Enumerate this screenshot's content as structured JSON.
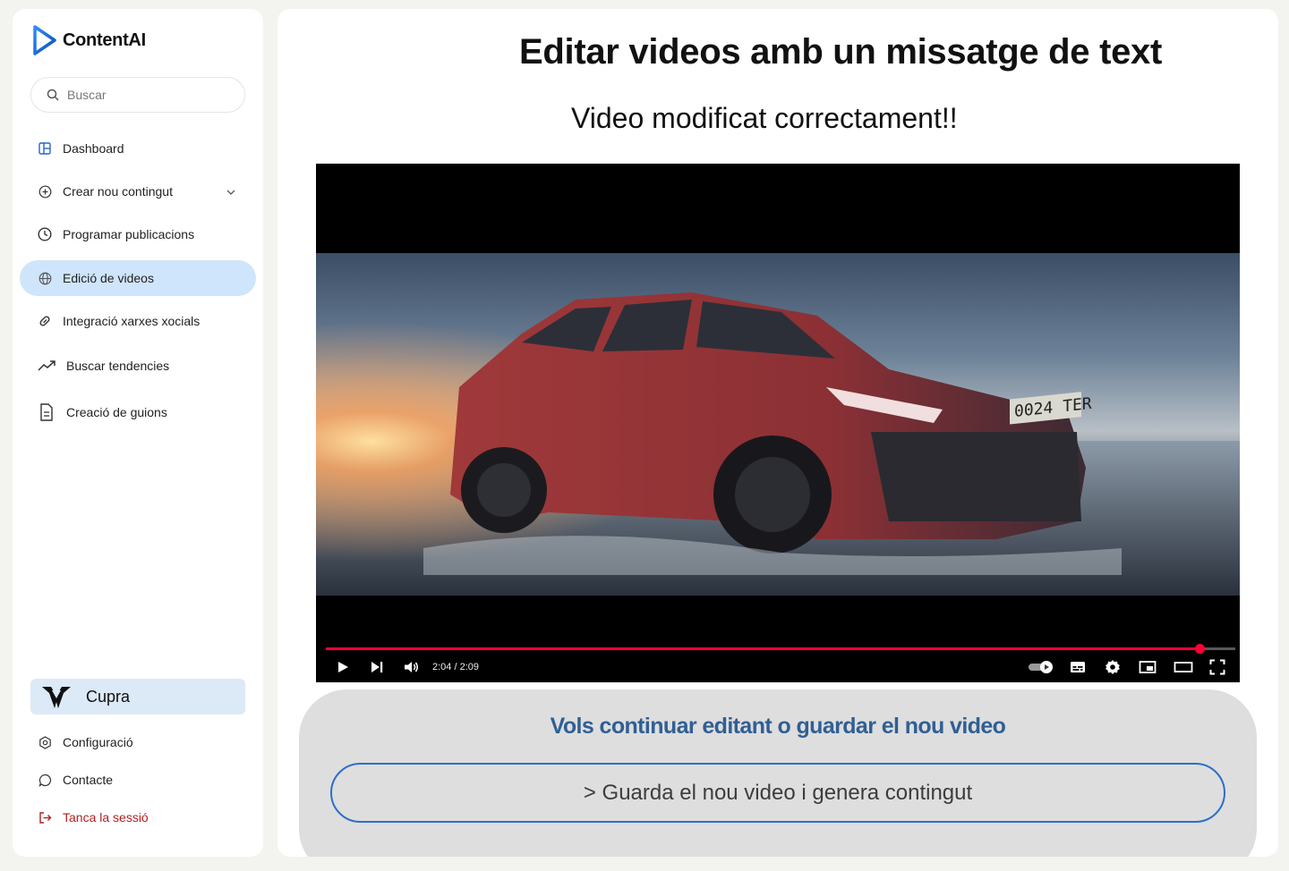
{
  "app": {
    "name": "ContentAI"
  },
  "search": {
    "placeholder": "Buscar"
  },
  "sidebar": {
    "items": [
      {
        "label": "Dashboard",
        "icon": "dashboard-icon"
      },
      {
        "label": "Crear nou contingut",
        "icon": "plus-circle-icon"
      },
      {
        "label": "Programar publicacions",
        "icon": "clock-icon"
      },
      {
        "label": "Edició de videos",
        "icon": "globe-icon",
        "active": true
      },
      {
        "label": "Integració xarxes xocials",
        "icon": "link-icon"
      },
      {
        "label": "Buscar tendencies",
        "icon": "trending-up-icon"
      },
      {
        "label": "Creació de guions",
        "icon": "document-icon"
      }
    ],
    "brand": {
      "label": "Cupra"
    },
    "bottom": [
      {
        "label": "Configuració",
        "icon": "gear-icon"
      },
      {
        "label": "Contacte",
        "icon": "chat-icon"
      },
      {
        "label": "Tanca la sessió",
        "icon": "logout-icon"
      }
    ]
  },
  "main": {
    "title": "Editar videos amb un missatge de text",
    "subtitle": "Video modificat correctament!!",
    "video": {
      "time": "2:04 / 2:09",
      "progress": 0.961,
      "plate": "0024 TER"
    },
    "panel": {
      "question": "Vols continuar editant o guardar el nou video",
      "button": "> Guarda el nou video i genera contingut"
    }
  },
  "colors": {
    "accent": "#2b6fca",
    "active_nav": "#cfe5fb",
    "logout": "#b51e1e",
    "progress": "#ff0033"
  }
}
